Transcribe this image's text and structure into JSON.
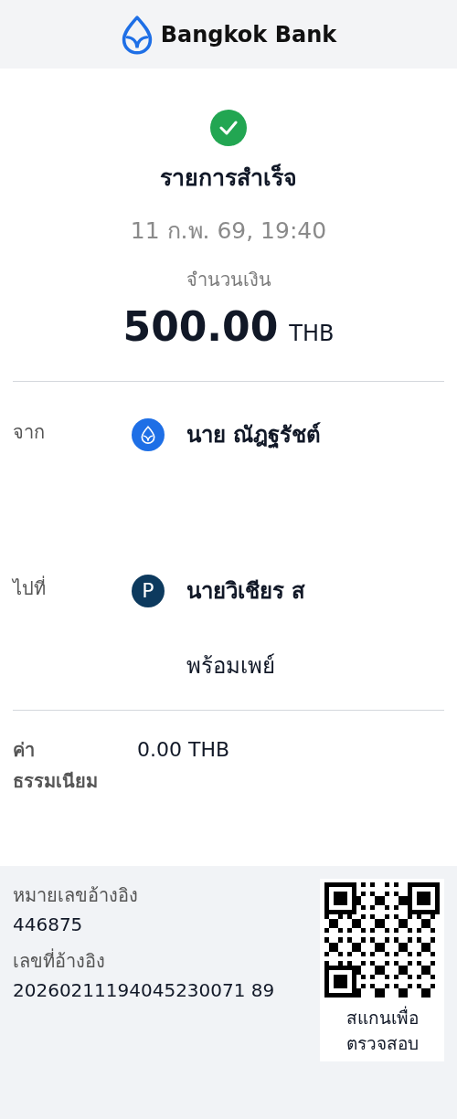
{
  "header": {
    "bank_name": "Bangkok Bank"
  },
  "status": {
    "kind": "success",
    "title": "รายการสำเร็จ",
    "datetime": "11 ก.พ. 69, 19:40"
  },
  "amount": {
    "label": "จำนวนเงิน",
    "value": "500.00",
    "currency": "THB"
  },
  "parties": [
    {
      "label": "จาก",
      "kind": "bank",
      "name": "นาย ณัฎฐรัชต์"
    },
    {
      "label": "ไปที่",
      "kind": "promptpay",
      "badge": "P",
      "name": "นายวิเชียร ส",
      "service": "พร้อมเพย์"
    }
  ],
  "fee": {
    "label": "ค่า ธรรมเนียม",
    "value": "0.00 THB"
  },
  "references": [
    {
      "label": "หมายเลขอ้างอิง",
      "value": "446875"
    },
    {
      "label": "เลขที่อ้างอิง",
      "value": "20260211194045230071 89"
    }
  ],
  "qr": {
    "caption": "สแกนเพื่อ ตรวจสอบ"
  }
}
